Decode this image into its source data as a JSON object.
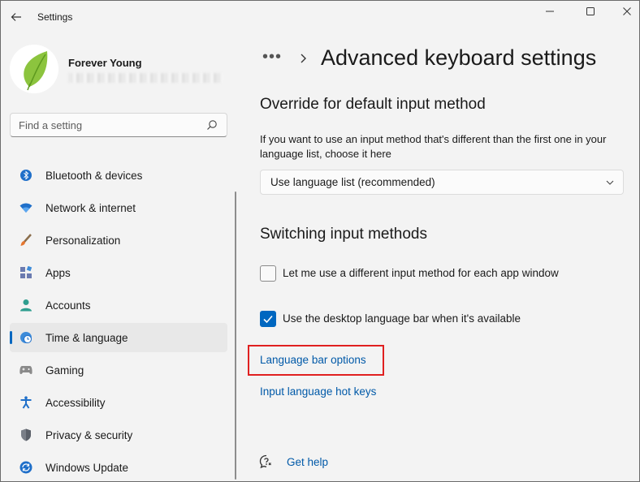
{
  "window": {
    "app_title": "Settings",
    "back_icon": "back-arrow-icon",
    "minimize_icon": "minimize-icon",
    "maximize_icon": "maximize-icon",
    "close_icon": "close-icon"
  },
  "profile": {
    "name": "Forever Young",
    "avatar_icon": "leaf-avatar"
  },
  "search": {
    "placeholder": "Find a setting",
    "icon": "search-icon"
  },
  "nav": {
    "items": [
      {
        "label": "Bluetooth & devices",
        "icon": "bluetooth-icon",
        "selected": false
      },
      {
        "label": "Network & internet",
        "icon": "wifi-icon",
        "selected": false
      },
      {
        "label": "Personalization",
        "icon": "brush-icon",
        "selected": false
      },
      {
        "label": "Apps",
        "icon": "apps-icon",
        "selected": false
      },
      {
        "label": "Accounts",
        "icon": "person-icon",
        "selected": false
      },
      {
        "label": "Time & language",
        "icon": "globe-clock-icon",
        "selected": true
      },
      {
        "label": "Gaming",
        "icon": "controller-icon",
        "selected": false
      },
      {
        "label": "Accessibility",
        "icon": "accessibility-icon",
        "selected": false
      },
      {
        "label": "Privacy & security",
        "icon": "shield-icon",
        "selected": false
      },
      {
        "label": "Windows Update",
        "icon": "update-icon",
        "selected": false
      }
    ]
  },
  "main": {
    "breadcrumb_more": "•••",
    "page_title": "Advanced keyboard settings",
    "override": {
      "heading": "Override for default input method",
      "description": "If you want to use an input method that's different than the first one in your language list, choose it here",
      "dropdown_value": "Use language list (recommended)"
    },
    "switching": {
      "heading": "Switching input methods",
      "checkbox1_label": "Let me use a different input method for each app window",
      "checkbox1_checked": false,
      "checkbox2_label": "Use the desktop language bar when it's available",
      "checkbox2_checked": true
    },
    "links": {
      "language_bar_options": "Language bar options",
      "input_hot_keys": "Input language hot keys"
    },
    "help": {
      "label": "Get help"
    }
  },
  "colors": {
    "accent": "#0067c0",
    "link": "#0059a8",
    "highlight": "#e02020",
    "background": "#f3f3f3"
  }
}
